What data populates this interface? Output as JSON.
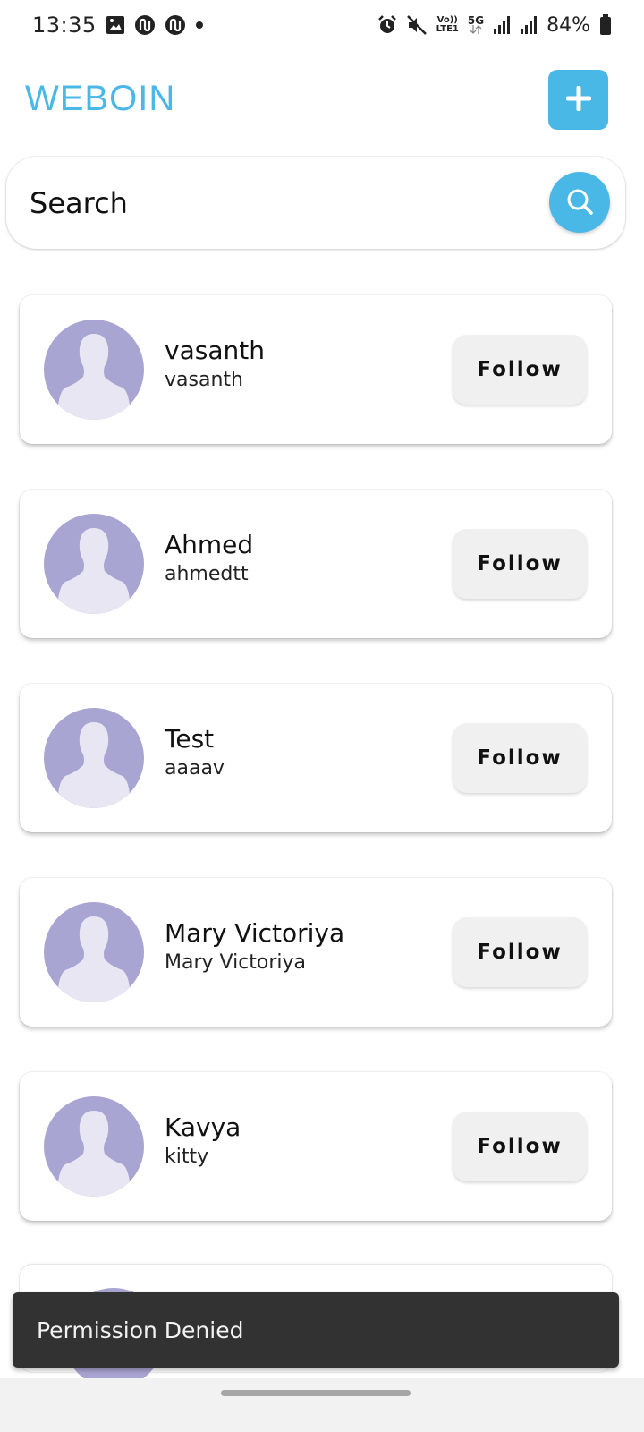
{
  "status_bar": {
    "time": "13:35",
    "battery": "84%",
    "network_top": "Vo))",
    "network_bottom": "LTE1",
    "five_g": "5G",
    "icons": [
      "gallery-icon",
      "app-notification-icon",
      "app-notification-icon",
      "dot-icon",
      "alarm-icon",
      "mute-icon",
      "signal-icon",
      "signal-icon",
      "battery-icon"
    ]
  },
  "header": {
    "title": "WEBOIN",
    "add_icon": "plus-icon"
  },
  "search": {
    "placeholder": "Search",
    "icon": "search-icon"
  },
  "users": [
    {
      "name": "vasanth",
      "handle": "vasanth",
      "button": "Follow"
    },
    {
      "name": "Ahmed",
      "handle": "ahmedtt",
      "button": "Follow"
    },
    {
      "name": "Test",
      "handle": "aaaav",
      "button": "Follow"
    },
    {
      "name": "Mary Victoriya",
      "handle": "Mary Victoriya",
      "button": "Follow"
    },
    {
      "name": "Kavya",
      "handle": "kitty",
      "button": "Follow"
    }
  ],
  "snackbar": {
    "message": "Permission Denied"
  },
  "colors": {
    "accent": "#4ab8e6",
    "avatar_bg": "#a9a5d3",
    "avatar_figure": "#e8e6f3",
    "follow_bg": "#f0f0f0",
    "snackbar_bg": "#323232"
  }
}
